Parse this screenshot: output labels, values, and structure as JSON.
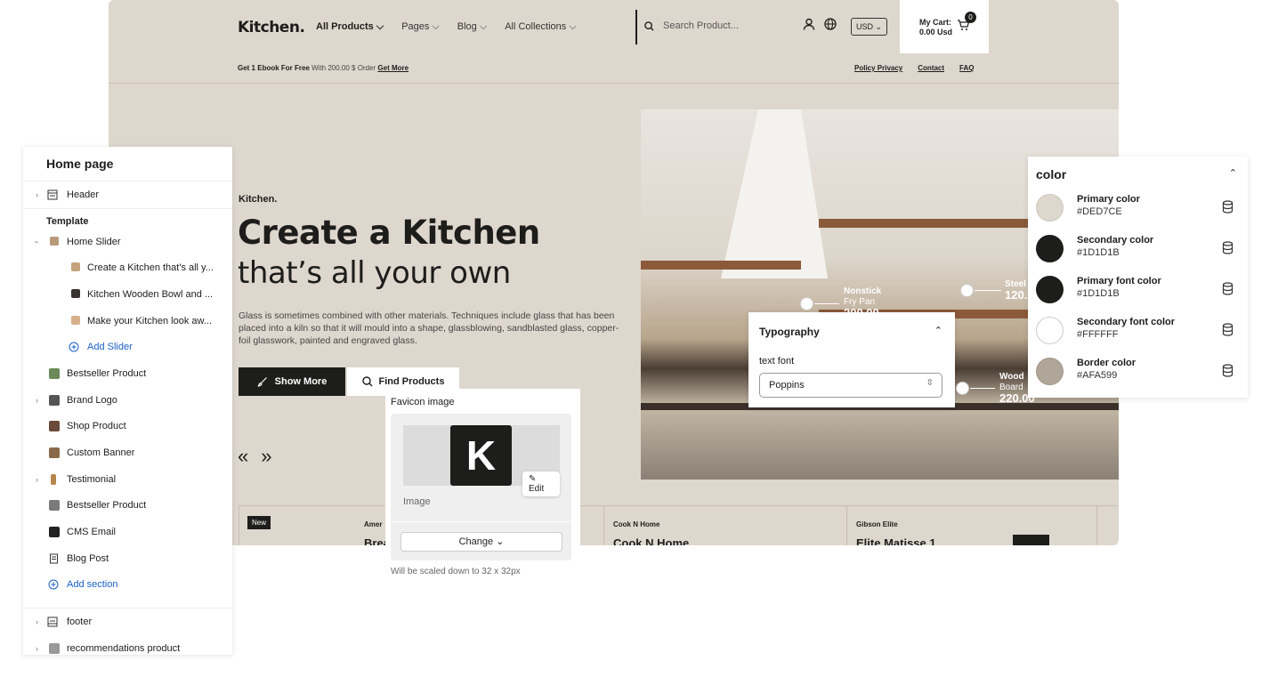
{
  "site": {
    "logo": "Kitchen.",
    "nav": [
      "All Products ⌵",
      "Pages ⌵",
      "Blog ⌵",
      "All Collections ⌵"
    ],
    "search_placeholder": "Search Product...",
    "currency": "USD ⌄",
    "cart_label": "My Cart:",
    "cart_total": "0.00 Usd",
    "cart_count": "0",
    "promo_bold": "Get 1 Ebook For Free",
    "promo_text": " With 200.00 $ Order ",
    "promo_link": "Get More",
    "top_links": [
      "Policy Privacy",
      "Contact",
      "FAQ"
    ],
    "hero": {
      "kicker": "Kitchen.",
      "title_line1": "Create a Kitchen",
      "title_line2": "that’s all your own",
      "paragraph": "Glass is sometimes combined with other materials. Techniques include glass that has been placed into a kiln so that it will mould into a shape, glassblowing, sandblasted glass, copper-foil glasswork, painted and engraved glass.",
      "btn_primary": "Show More",
      "btn_secondary": "Find Products",
      "prev": "«",
      "next": "»"
    },
    "hotspots": [
      {
        "name": "Nonstick",
        "sub": "Fry Pan",
        "price": "200.00"
      },
      {
        "name": "Steel",
        "sub": "",
        "price": "120.0"
      },
      {
        "name": "Wood",
        "sub": "Board",
        "price": "220.00"
      }
    ],
    "products": [
      {
        "badge": "New",
        "brand": "Amer",
        "title": "Brea"
      },
      {
        "brand": "Cook N Home",
        "title": "Cook N Home"
      },
      {
        "brand": "Gibson Elite",
        "title": "Elite Matisse 1"
      }
    ]
  },
  "sidebar": {
    "title": "Home page",
    "header_item": "Header",
    "template_label": "Template",
    "home_slider": "Home Slider",
    "slides": [
      "Create a Kitchen that's all y...",
      "Kitchen Wooden Bowl and ...",
      "Make your Kitchen look aw..."
    ],
    "add_slider": "Add Slider",
    "sections": [
      "Bestseller Product",
      "Brand Logo",
      "Shop Product",
      "Custom Banner",
      "Testimonial",
      "Bestseller Product",
      "CMS Email",
      "Blog Post"
    ],
    "add_section": "Add section",
    "footer": "footer",
    "last": "recommendations product"
  },
  "typography": {
    "title": "Typography",
    "label": "text font",
    "value": "Poppins"
  },
  "favicon": {
    "label": "Favicon image",
    "letter": "K",
    "edit": "Edit",
    "image_label": "Image",
    "change": "Change",
    "note": "Will be scaled down to 32 x 32px"
  },
  "colors": {
    "title": "color",
    "items": [
      {
        "name": "Primary color",
        "value": "#DED7CE"
      },
      {
        "name": "Secondary color",
        "value": "#1D1D1B"
      },
      {
        "name": "Primary font color",
        "value": "#1D1D1B"
      },
      {
        "name": "Secondary font color",
        "value": "#FFFFFF"
      },
      {
        "name": "Border color",
        "value": "#AFA599"
      }
    ]
  }
}
